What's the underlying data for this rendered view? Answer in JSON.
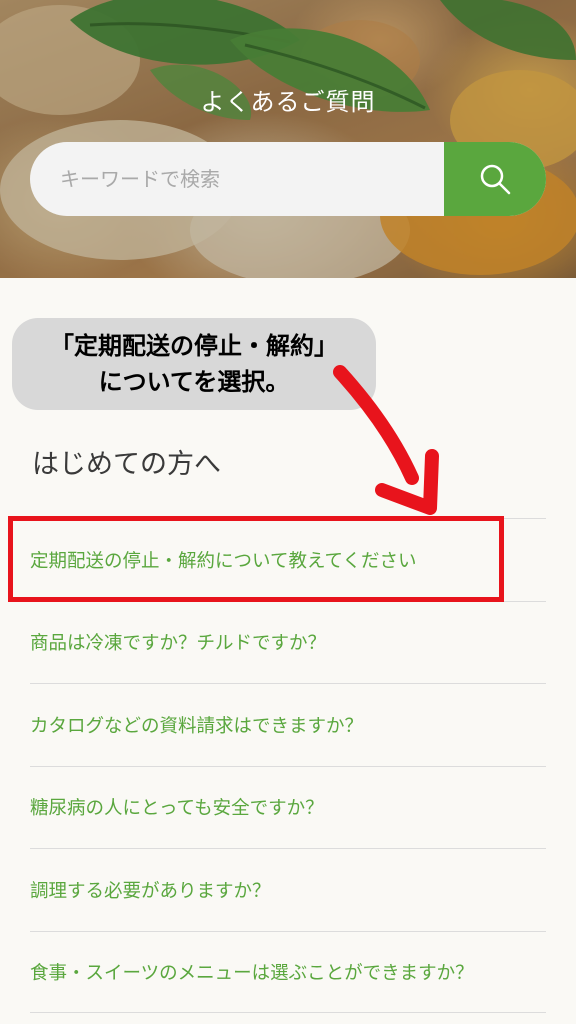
{
  "header": {
    "title": "よくあるご質問"
  },
  "search": {
    "placeholder": "キーワードで検索",
    "button_icon": "search-icon"
  },
  "annotation": {
    "line1": "「定期配送の停止・解約」",
    "line2": "についてを選択。",
    "highlight_color": "#e8141c"
  },
  "section": {
    "heading": "はじめての方へ"
  },
  "faq": {
    "items": [
      {
        "label": "定期配送の停止・解約について教えてください"
      },
      {
        "label": "商品は冷凍ですか？チルドですか？"
      },
      {
        "label": "カタログなどの資料請求はできますか？"
      },
      {
        "label": "糖尿病の人にとっても安全ですか？"
      },
      {
        "label": "調理する必要がありますか？"
      },
      {
        "label": "食事・スイーツのメニューは選ぶことができますか？"
      }
    ]
  },
  "colors": {
    "accent": "#5aa73e",
    "link": "#5aa73e",
    "highlight": "#e8141c"
  }
}
